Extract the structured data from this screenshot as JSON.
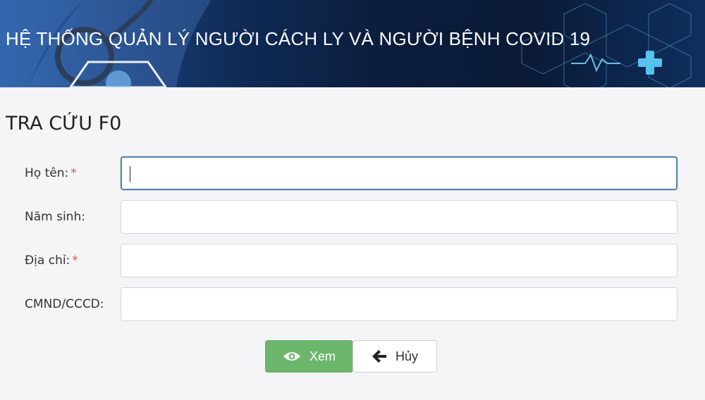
{
  "header": {
    "title": "HỆ THỐNG QUẢN LÝ NGƯỜI CÁCH LY VÀ NGƯỜI BỆNH COVID 19"
  },
  "page": {
    "title": "TRA CỨU F0"
  },
  "form": {
    "fields": [
      {
        "label": "Họ tên:",
        "required": true,
        "value": "",
        "focused": true
      },
      {
        "label": "Năm sinh:",
        "required": false,
        "value": ""
      },
      {
        "label": "Địa chỉ:",
        "required": true,
        "value": ""
      },
      {
        "label": "CMND/CCCD:",
        "required": false,
        "value": ""
      }
    ],
    "required_marker": "*"
  },
  "actions": {
    "view_label": "Xem",
    "view_icon": "eye-icon",
    "cancel_label": "Hủy",
    "cancel_icon": "arrow-left-icon"
  },
  "colors": {
    "primary_button": "#6cb66c",
    "required_marker": "#d9534f",
    "banner_dark": "#0b1d3d"
  }
}
